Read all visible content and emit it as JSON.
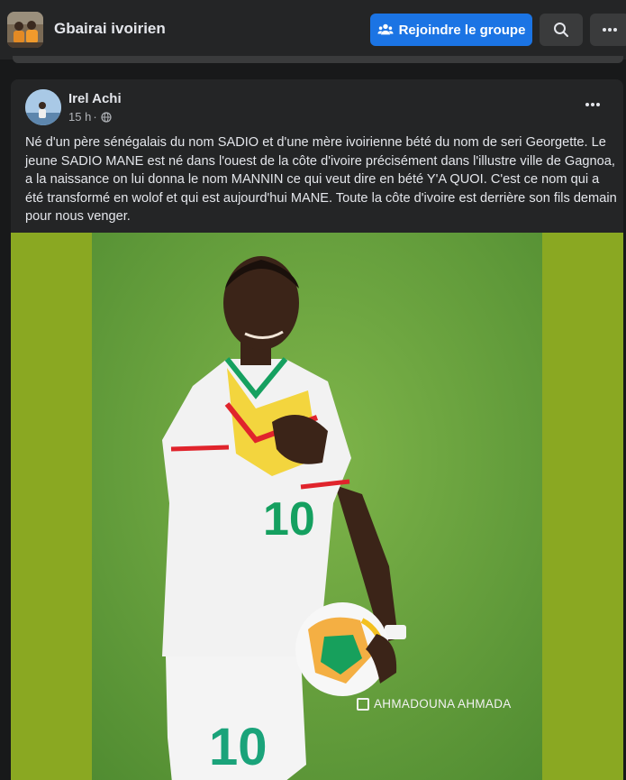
{
  "header": {
    "group_name": "Gbairai ivoirien",
    "join_label": "Rejoindre le groupe",
    "accent_color": "#1b74e4"
  },
  "post": {
    "author": "Irel Achi",
    "time": "15 h",
    "visibility_icon": "globe-icon",
    "text": "Né d'un père sénégalais du nom SADIO et d'une mère ivoirienne bété du nom de seri Georgette. Le jeune SADIO MANE est né dans l'ouest de la côte d'ivoire précisément dans l'illustre ville de Gagnoa, a la naissance on lui donna le nom MANNIN ce qui veut dire en bété Y'A QUOI. C'est ce nom qui a été transformé en wolof et qui est aujourd'hui MANE. Toute la côte d'ivoire est derrière son fils demain pour nous venger.",
    "image": {
      "watermark": "AHMADOUNA AHMADA",
      "jersey_number": "10"
    }
  }
}
